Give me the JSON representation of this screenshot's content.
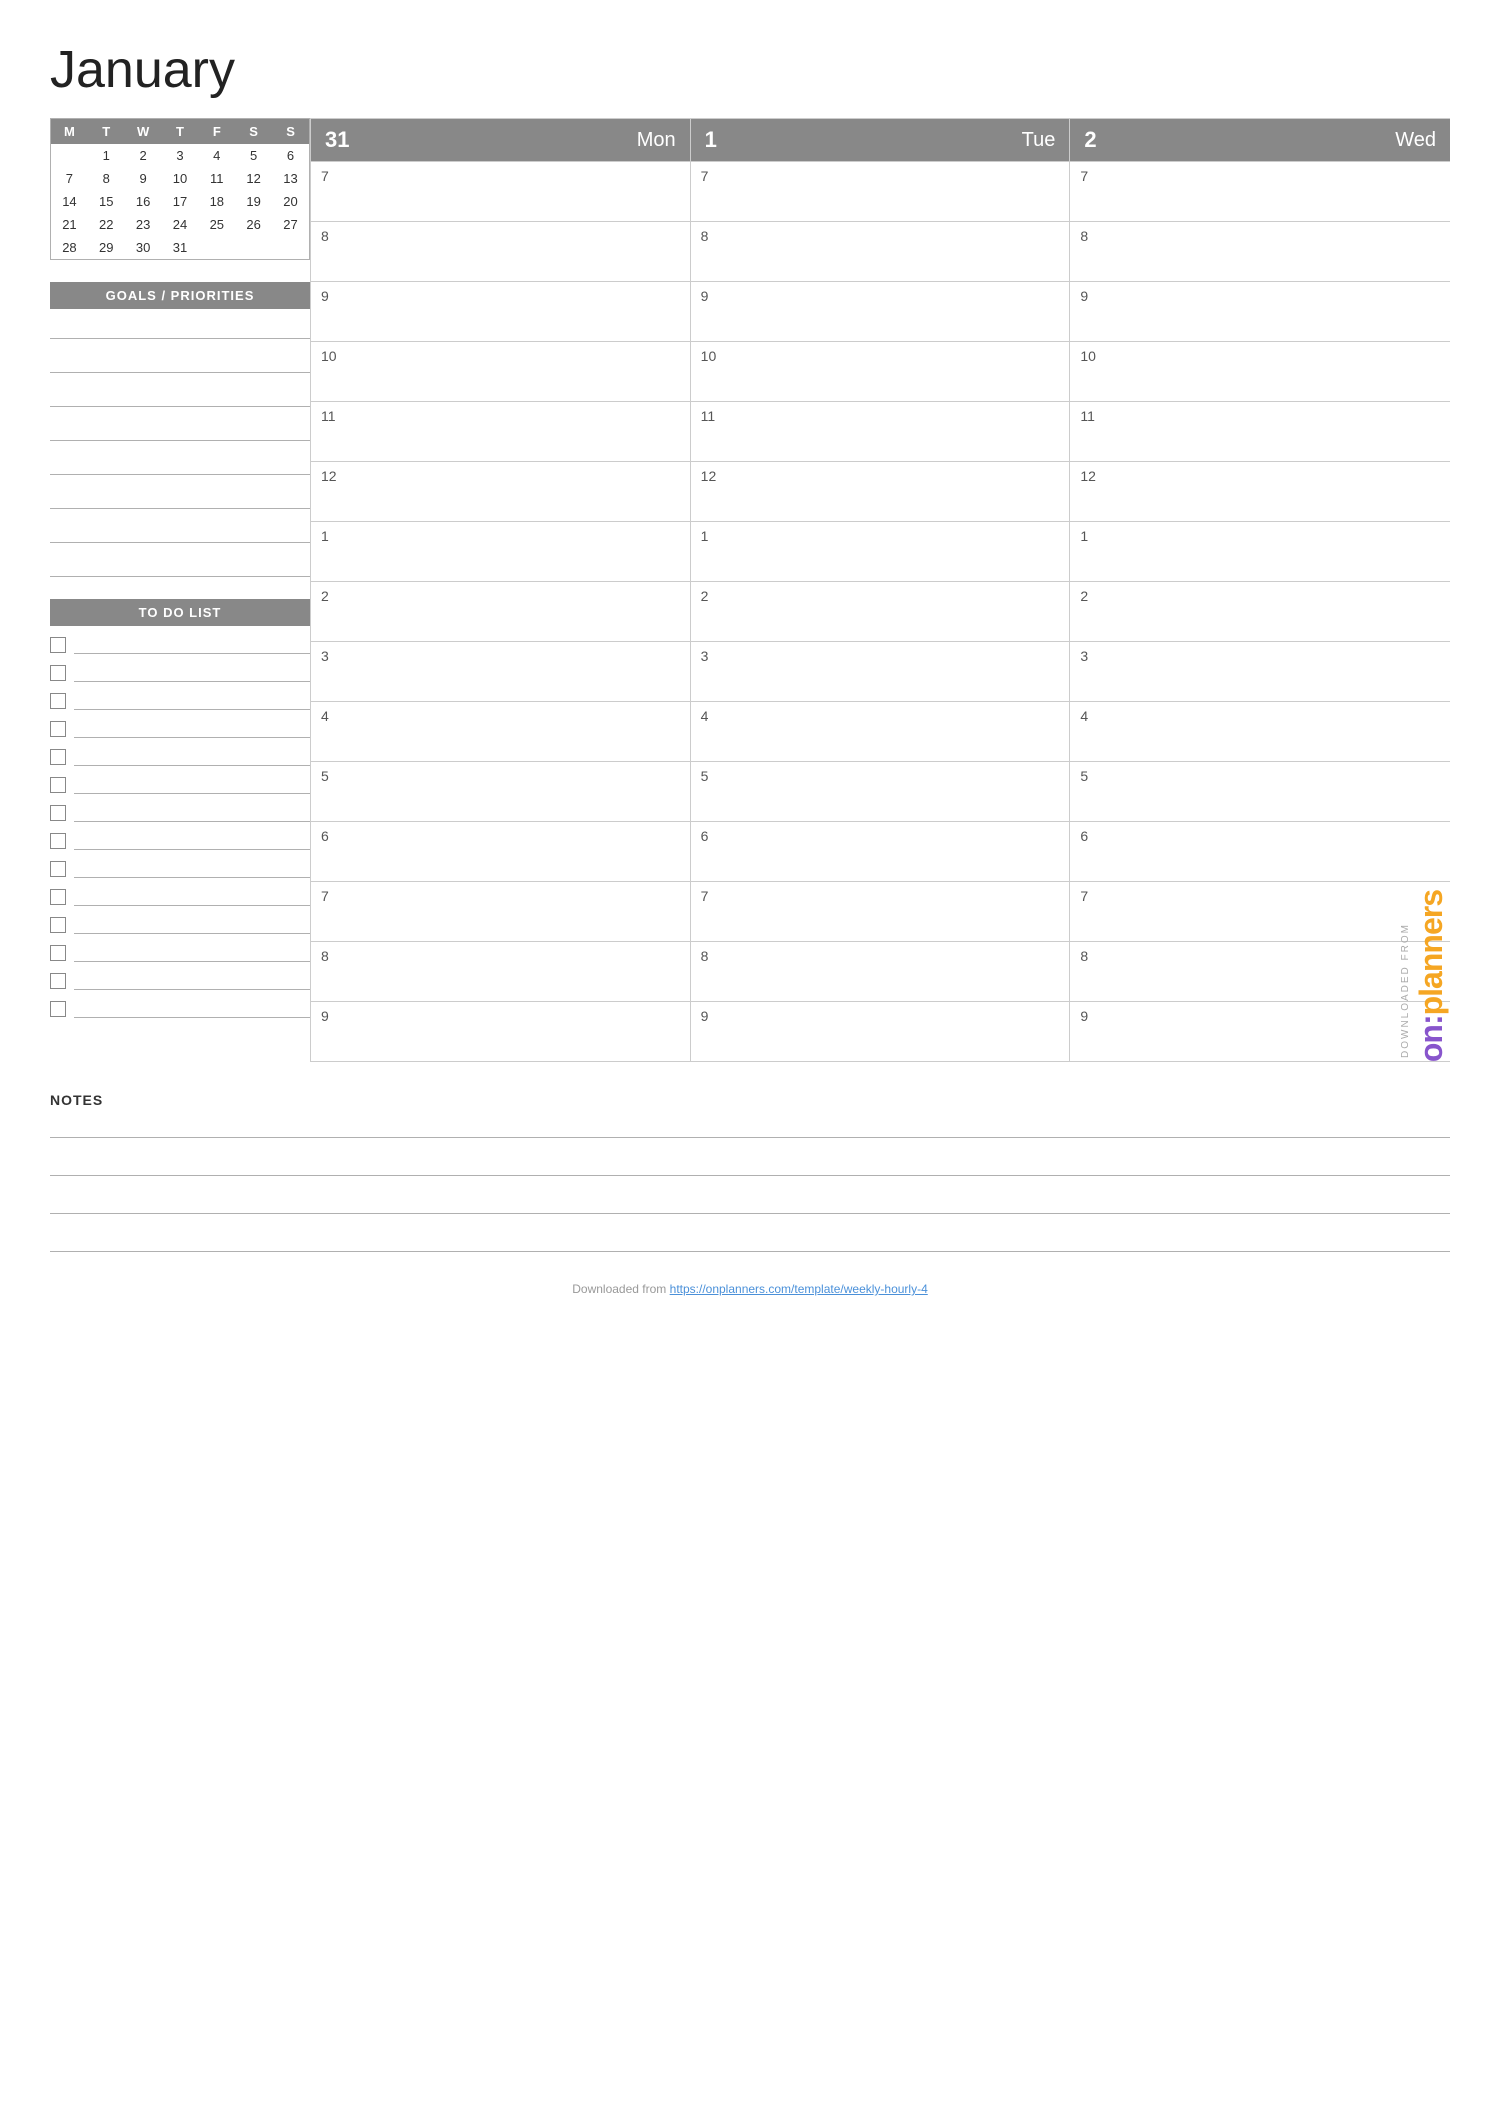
{
  "page": {
    "title": "January"
  },
  "mini_calendar": {
    "headers": [
      "M",
      "T",
      "W",
      "T",
      "F",
      "S",
      "S"
    ],
    "rows": [
      [
        null,
        "1",
        "2",
        "3",
        "4",
        "5",
        "6"
      ],
      [
        "7",
        "8",
        "9",
        "10",
        "11",
        "12",
        "13"
      ],
      [
        "14",
        "15",
        "16",
        "17",
        "18",
        "19",
        "20"
      ],
      [
        "21",
        "22",
        "23",
        "24",
        "25",
        "26",
        "27"
      ],
      [
        "28",
        "29",
        "30",
        "31",
        null,
        null,
        null
      ]
    ]
  },
  "goals_section": {
    "label": "GOALS / PRIORITIES",
    "lines": 8
  },
  "todo_section": {
    "label": "TO DO LIST",
    "items": 14
  },
  "notes_section": {
    "label": "NOTES",
    "lines": 4
  },
  "days": [
    {
      "num": "31",
      "name": "Mon"
    },
    {
      "num": "1",
      "name": "Tue"
    },
    {
      "num": "2",
      "name": "Wed"
    }
  ],
  "hours": [
    "7",
    "7",
    "7",
    "8",
    "8",
    "8",
    "9",
    "9",
    "9",
    "10",
    "10",
    "10",
    "11",
    "11",
    "11",
    "12",
    "12",
    "12",
    "1",
    "1",
    "1",
    "2",
    "2",
    "2",
    "3",
    "3",
    "3",
    "4",
    "4",
    "4",
    "5",
    "5",
    "5",
    "6",
    "6",
    "6",
    "7",
    "7",
    "7",
    "8",
    "8",
    "8",
    "9",
    "9",
    "9"
  ],
  "watermark": {
    "downloaded": "DOWNLOADED FROM",
    "brand_on": "on:",
    "brand_planners": "planners"
  },
  "footer": {
    "text": "Downloaded from",
    "url": "https://onplanners.com/template/weekly-hourly-4"
  }
}
